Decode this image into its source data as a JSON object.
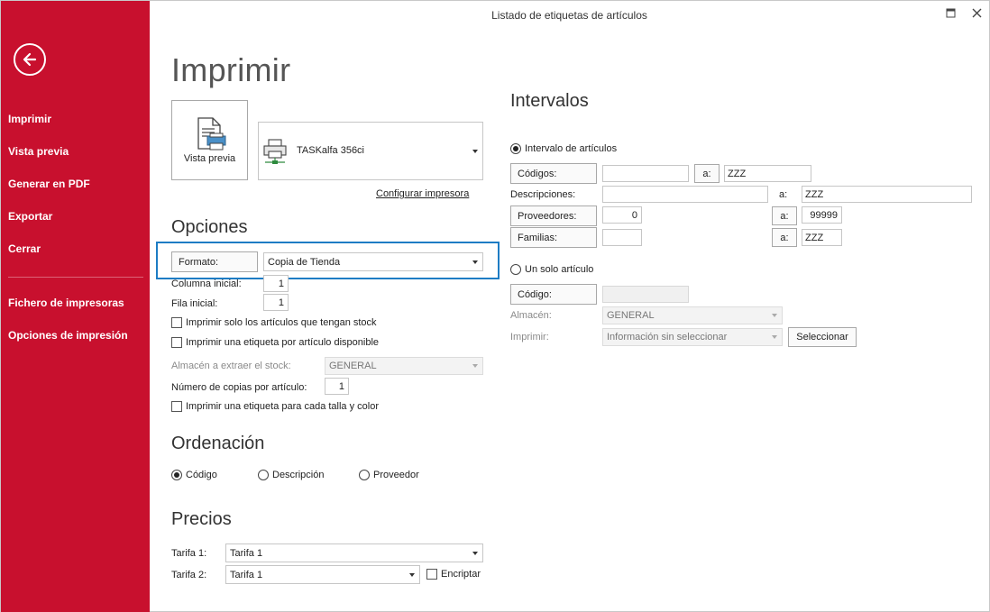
{
  "window": {
    "title": "Listado de etiquetas de artículos",
    "maximize_glyph": "□",
    "close_glyph": "✕"
  },
  "sidebar": {
    "bg_color": "#c8102e",
    "back_icon": "arrow-left-circle-icon",
    "items": [
      {
        "label": "Imprimir"
      },
      {
        "label": "Vista previa"
      },
      {
        "label": "Generar en PDF"
      },
      {
        "label": "Exportar"
      },
      {
        "label": "Cerrar"
      },
      {
        "label": "Fichero de impresoras"
      },
      {
        "label": "Opciones de impresión"
      }
    ]
  },
  "main": {
    "title": "Imprimir",
    "preview_button": {
      "label": "Vista previa",
      "icon": "print-preview-icon"
    },
    "printer": {
      "name": "TASKalfa 356ci",
      "icon": "network-printer-icon"
    },
    "configure_printer": "Configurar impresora"
  },
  "opciones": {
    "heading": "Opciones",
    "formato_label": "Formato:",
    "formato_value": "Copia de Tienda",
    "columna_label": "Columna inicial:",
    "columna_value": "1",
    "fila_label": "Fila inicial:",
    "fila_value": "1",
    "chk_stock": "Imprimir solo los artículos que tengan stock",
    "chk_por_articulo": "Imprimir una etiqueta por artículo disponible",
    "almacen_label": "Almacén a extraer el stock:",
    "almacen_value": "GENERAL",
    "copias_label": "Número de copias por artículo:",
    "copias_value": "1",
    "chk_talla_color": "Imprimir una etiqueta para cada talla y color"
  },
  "ordenacion": {
    "heading": "Ordenación",
    "options": [
      "Código",
      "Descripción",
      "Proveedor"
    ],
    "selected": "Código"
  },
  "precios": {
    "heading": "Precios",
    "tarifa1_label": "Tarifa 1:",
    "tarifa1_value": "Tarifa 1",
    "tarifa2_label": "Tarifa 2:",
    "tarifa2_value": "Tarifa 1",
    "encriptar_label": "Encriptar"
  },
  "intervalos": {
    "heading": "Intervalos",
    "radio_intervalo": "Intervalo de artículos",
    "codigos_label": "Códigos:",
    "codigos_from": "",
    "a_label": "a:",
    "codigos_to": "ZZZ",
    "descripciones_label": "Descripciones:",
    "descripciones_from": "",
    "descripciones_to": "ZZZ",
    "proveedores_label": "Proveedores:",
    "proveedores_from": "0",
    "proveedores_to": "99999",
    "familias_label": "Familias:",
    "familias_from": "",
    "familias_to": "ZZZ",
    "radio_uno": "Un solo artículo",
    "codigo_label": "Código:",
    "codigo_value": "",
    "almacen_label": "Almacén:",
    "almacen_value": "GENERAL",
    "imprimir_label": "Imprimir:",
    "imprimir_value": "Información sin seleccionar",
    "seleccionar_label": "Seleccionar"
  }
}
